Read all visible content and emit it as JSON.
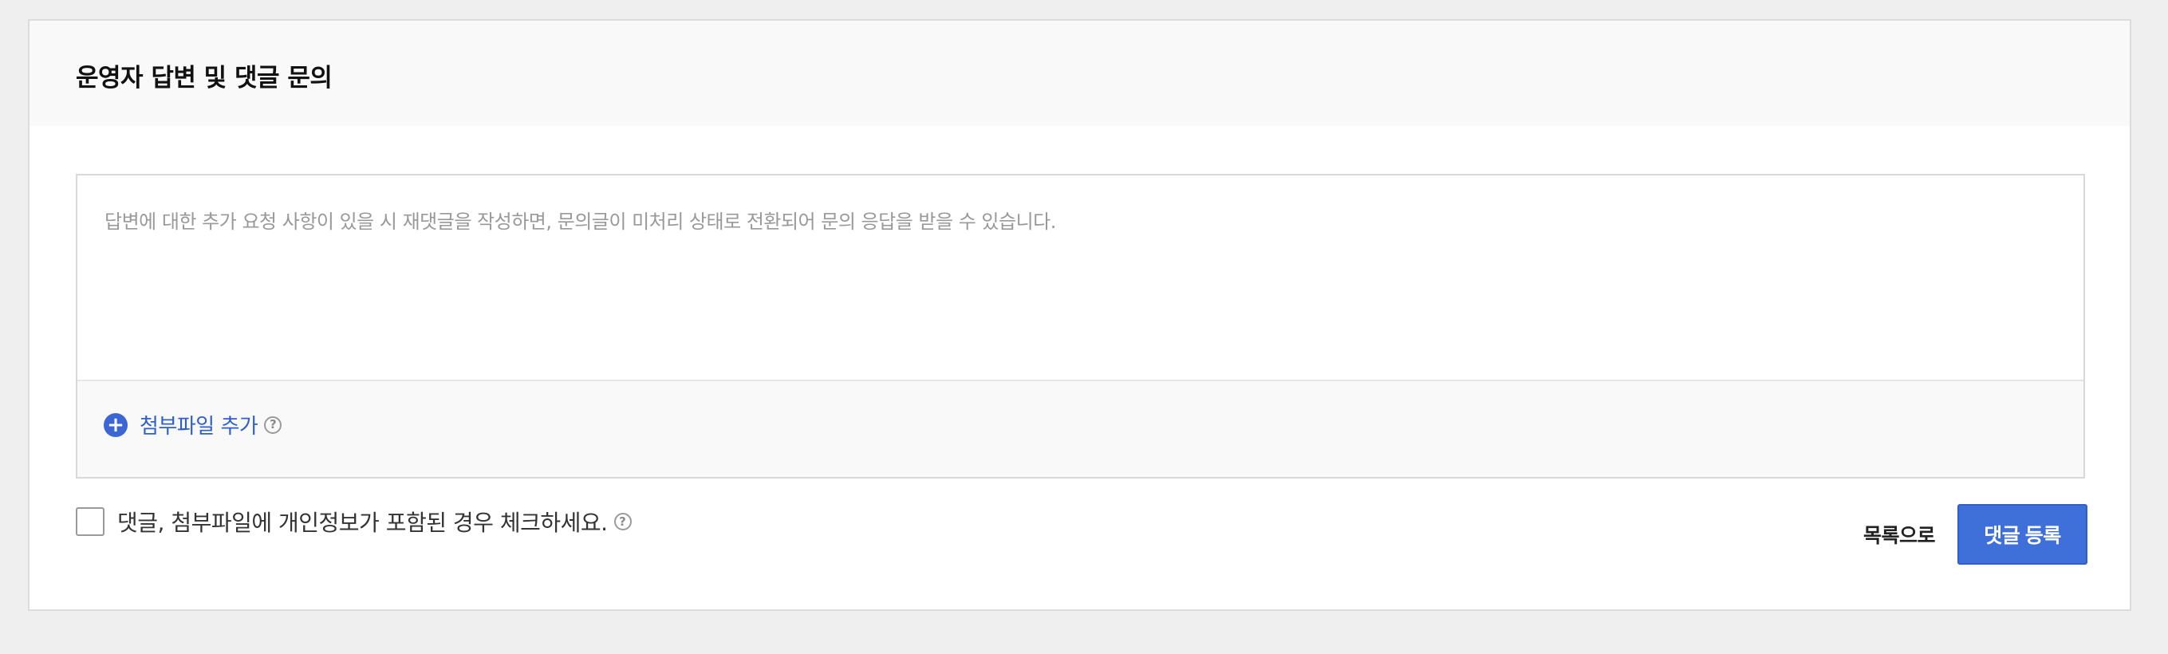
{
  "card": {
    "title": "운영자 답변 및 댓글 문의"
  },
  "editor": {
    "placeholder": "답변에 대한 추가 요청 사항이 있을 시 재댓글을 작성하면, 문의글이 미처리 상태로 전환되어 문의 응답을 받을 수 있습니다.",
    "value": ""
  },
  "attach": {
    "icon": "plus-circle-icon",
    "label": "첨부파일 추가",
    "help_icon": "question-circle-icon",
    "help_glyph": "?"
  },
  "privacy": {
    "label": "댓글, 첨부파일에 개인정보가 포함된 경우 체크하세요.",
    "checked": false,
    "help_icon": "question-circle-icon",
    "help_glyph": "?"
  },
  "actions": {
    "list_label": "목록으로",
    "submit_label": "댓글 등록"
  },
  "colors": {
    "accent": "#3f6fd8",
    "link": "#2f5fc8",
    "background": "#efefef",
    "header_bg": "#f9f9f9"
  }
}
